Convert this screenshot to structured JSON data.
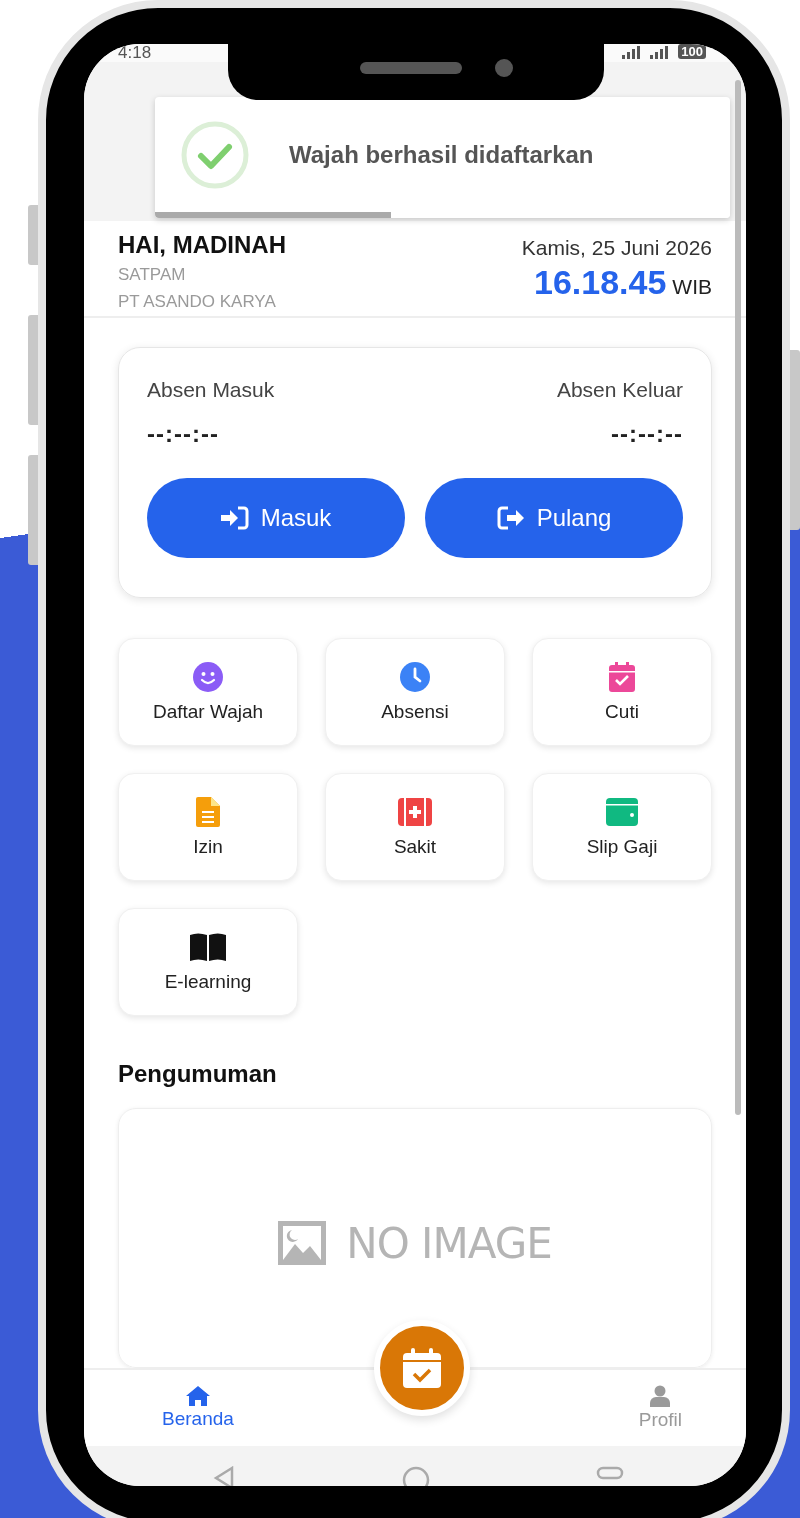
{
  "status_bar": {
    "time": "4:18",
    "battery": "100"
  },
  "toast": {
    "message": "Wajah berhasil didaftarkan",
    "level": 0.41
  },
  "header": {
    "greeting": "HAI, MADINAH",
    "role": "SATPAM",
    "company": "PT ASANDO KARYA",
    "date": "Kamis, 25 Juni 2026",
    "time": "16.18.45",
    "timezone": "WIB"
  },
  "attendance": {
    "check_in": {
      "label": "Absen Masuk",
      "value": "--:--:--"
    },
    "check_out": {
      "label": "Absen Keluar",
      "value": "--:--:--"
    },
    "buttons": [
      {
        "label": "Masuk",
        "kind": "in"
      },
      {
        "label": "Pulang",
        "kind": "out"
      }
    ]
  },
  "menu": [
    {
      "label": "Daftar Wajah",
      "kind": "face",
      "color": "#8b5cf6"
    },
    {
      "label": "Absensi",
      "kind": "clock",
      "color": "#3b82f6"
    },
    {
      "label": "Cuti",
      "kind": "calendar",
      "color": "#ec4899"
    },
    {
      "label": "Izin",
      "kind": "document",
      "color": "#f59e0b"
    },
    {
      "label": "Sakit",
      "kind": "medical",
      "color": "#ef4444"
    },
    {
      "label": "Slip Gaji",
      "kind": "wallet",
      "color": "#10b981"
    },
    {
      "label": "E-learning",
      "kind": "book",
      "color": "#111111"
    }
  ],
  "announcements": {
    "title": "Pengumuman",
    "image_text": "NO IMAGE"
  },
  "bottom_nav": [
    {
      "label": "Beranda",
      "kind": "home",
      "selected": true
    },
    {
      "label": "Profil",
      "kind": "profile",
      "selected": false
    }
  ]
}
